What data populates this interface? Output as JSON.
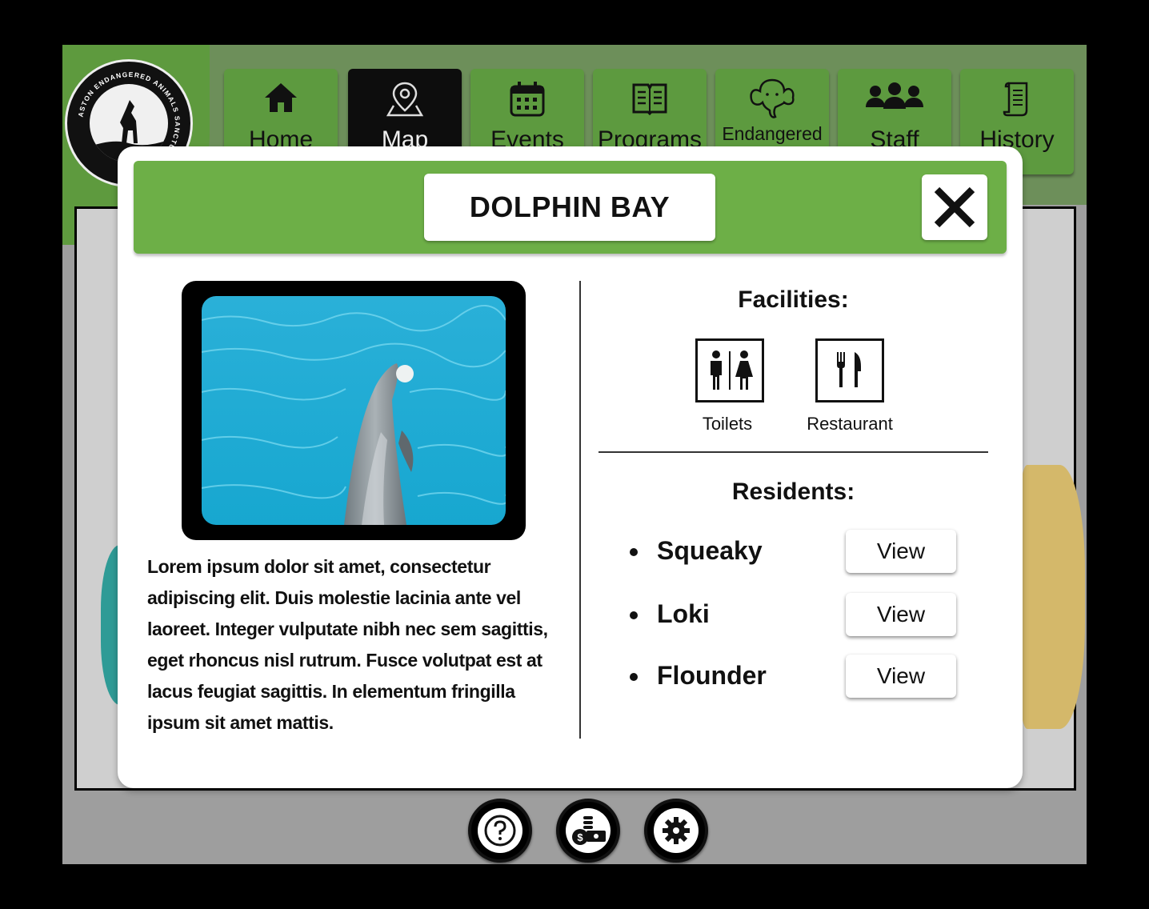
{
  "logo": {
    "text": "ASTON ENDANGERED ANIMALS SANCTUARY"
  },
  "nav": {
    "tabs": [
      {
        "label": "Home",
        "icon": "home-icon"
      },
      {
        "label": "Map",
        "icon": "map-pin-icon",
        "active": true
      },
      {
        "label": "Events",
        "icon": "calendar-icon"
      },
      {
        "label": "Programs",
        "icon": "book-icon"
      },
      {
        "label": "Endangered",
        "icon": "elephant-icon"
      },
      {
        "label": "Staff",
        "icon": "people-icon"
      },
      {
        "label": "History",
        "icon": "scroll-icon"
      }
    ]
  },
  "modal": {
    "title": "DOLPHIN BAY",
    "description": "Lorem ipsum dolor sit amet, consectetur adipiscing elit. Duis molestie lacinia ante vel laoreet. Integer vulputate nibh nec sem sagittis, eget rhoncus nisl rutrum. Fusce volutpat est at lacus feugiat sagittis. In elementum fringilla ipsum sit amet mattis.",
    "facilities_heading": "Facilities:",
    "facilities": [
      {
        "label": "Toilets",
        "icon": "toilets-icon"
      },
      {
        "label": "Restaurant",
        "icon": "restaurant-icon"
      }
    ],
    "residents_heading": "Residents:",
    "residents": [
      {
        "name": "Squeaky",
        "button": "View"
      },
      {
        "name": "Loki",
        "button": "View"
      },
      {
        "name": "Flounder",
        "button": "View"
      }
    ]
  },
  "bottom_buttons": [
    {
      "icon": "help-icon"
    },
    {
      "icon": "donate-icon"
    },
    {
      "icon": "settings-icon"
    }
  ],
  "colors": {
    "green": "#6daf47",
    "nav_green": "#5d9a3f",
    "active_tab": "#0d0d0d"
  }
}
